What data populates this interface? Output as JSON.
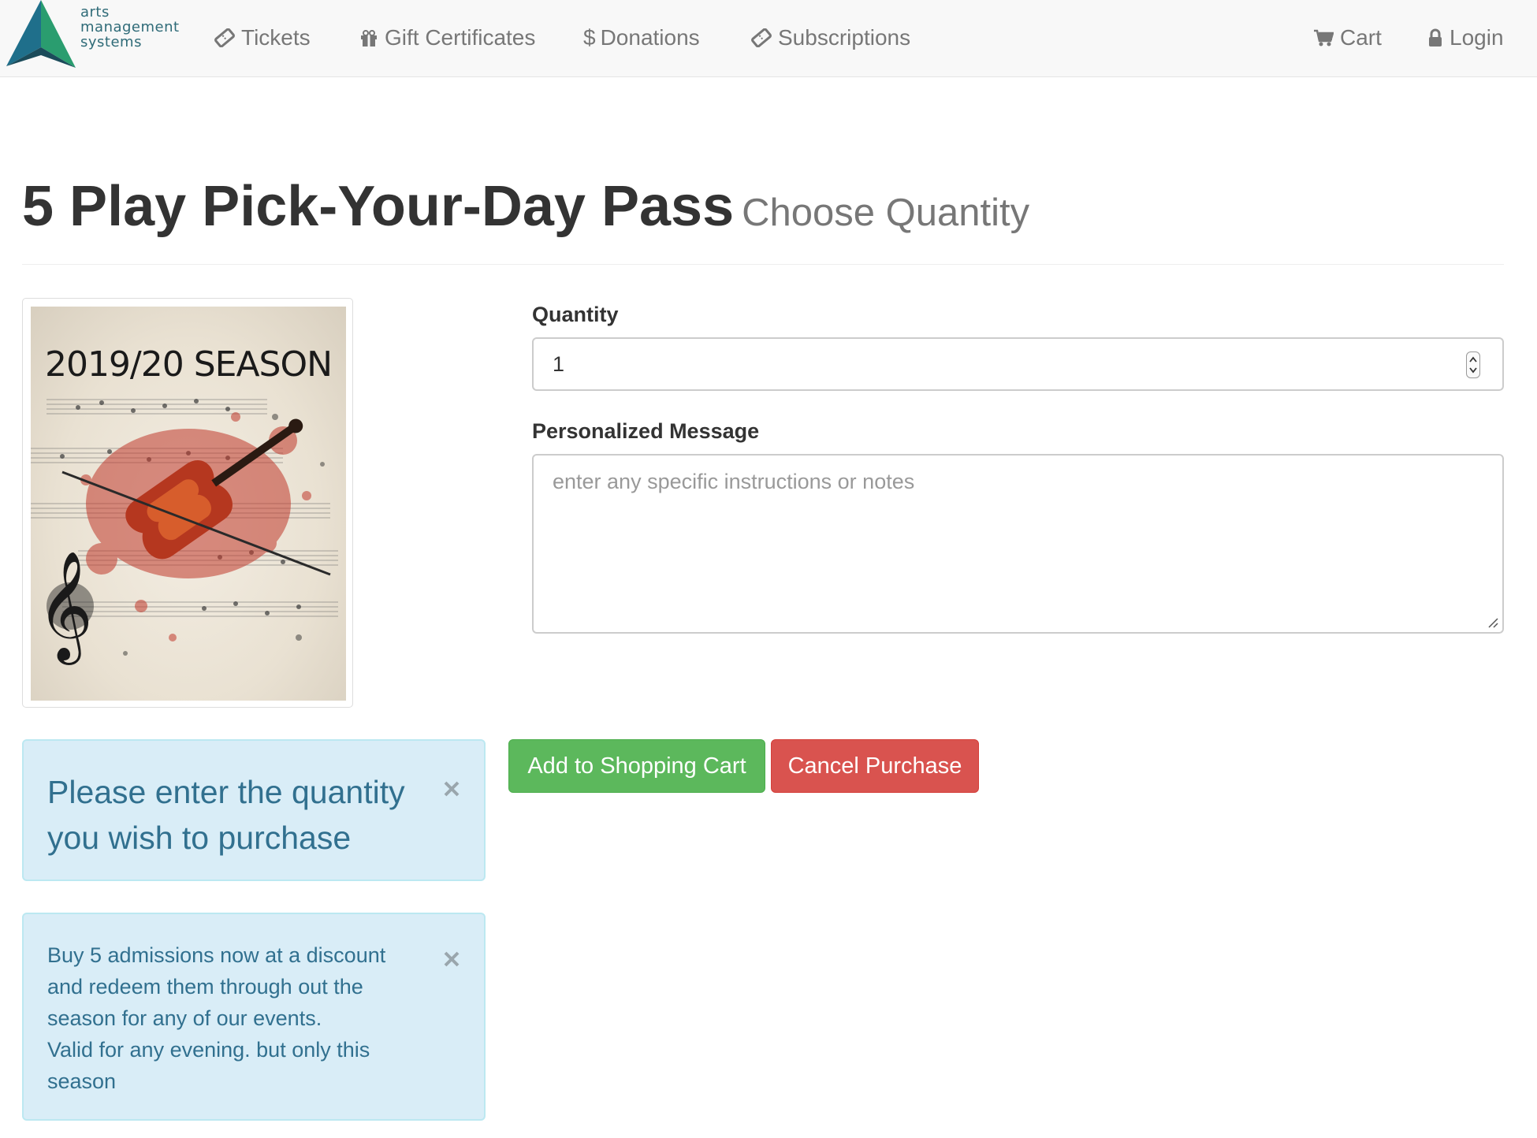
{
  "brand": {
    "line1": "arts",
    "line2": "management",
    "line3": "systems"
  },
  "nav": {
    "tickets": "Tickets",
    "gift_certificates": "Gift Certificates",
    "donations": "Donations",
    "subscriptions": "Subscriptions",
    "cart": "Cart",
    "login": "Login"
  },
  "header": {
    "title": "5 Play Pick-Your-Day Pass",
    "subtitle": "Choose Quantity"
  },
  "product_image": {
    "caption": "2019/20 SEASON"
  },
  "form": {
    "quantity_label": "Quantity",
    "quantity_value": "1",
    "message_label": "Personalized Message",
    "message_placeholder": "enter any specific instructions or notes"
  },
  "buttons": {
    "add_to_cart": "Add to Shopping Cart",
    "cancel": "Cancel Purchase"
  },
  "alerts": {
    "quantity_prompt": "Please enter the quantity you wish to purchase",
    "description_lines": [
      "Buy 5 admissions now at a discount",
      "and redeem them through out the",
      "season for any of our events.",
      "Valid for any evening. but only this",
      "season"
    ]
  },
  "colors": {
    "success": "#5cb85c",
    "danger": "#d9534f",
    "info_bg": "#d9edf7",
    "info_text": "#31708f",
    "brand_teal": "#2f6b78"
  }
}
